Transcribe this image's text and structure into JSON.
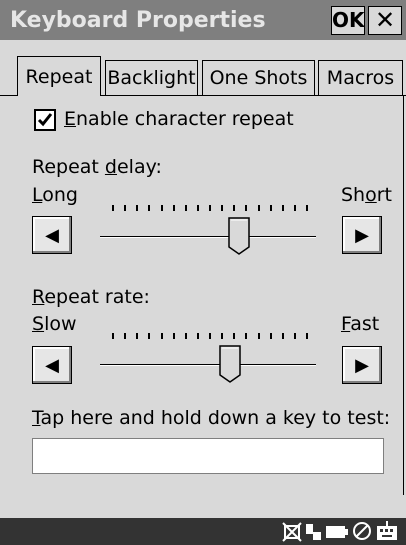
{
  "window": {
    "title": "Keyboard Properties",
    "ok_label": "OK",
    "close_glyph": "✕"
  },
  "tabs": [
    {
      "label": "Repeat",
      "active": true
    },
    {
      "label": "Backlight",
      "active": false
    },
    {
      "label": "One Shots",
      "active": false
    },
    {
      "label": "Macros",
      "active": false
    }
  ],
  "repeat": {
    "enable_checked": true,
    "enable_label_mnemonic": "E",
    "enable_label_rest": "nable character repeat",
    "delay": {
      "label_pre": "Repeat ",
      "label_mnemonic": "d",
      "label_post": "elay:",
      "left_mnemonic": "L",
      "left_rest": "ong",
      "right_pre": "Sh",
      "right_mnemonic": "o",
      "right_post": "rt",
      "value_fraction": 0.65
    },
    "rate": {
      "label_mnemonic": "R",
      "label_rest": "epeat rate:",
      "left_mnemonic": "S",
      "left_rest": "low",
      "right_mnemonic": "F",
      "right_rest": "ast",
      "value_fraction": 0.6
    },
    "test_label_mnemonic": "T",
    "test_label_rest": "ap here and hold down a key to test:",
    "test_value": ""
  },
  "icons": {
    "left_arrow": "◀",
    "right_arrow": "▶",
    "taskbar": [
      "network-disconnected-icon",
      "connection-icon",
      "battery-icon",
      "blocked-icon",
      "keyboard-icon"
    ]
  }
}
